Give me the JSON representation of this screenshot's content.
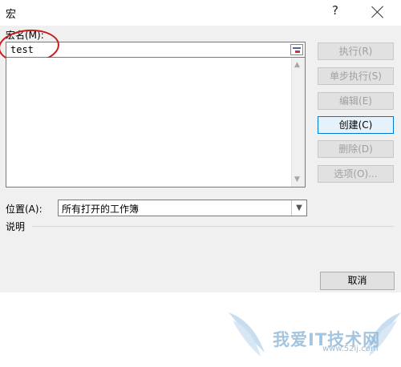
{
  "window": {
    "title": "宏",
    "help": "?"
  },
  "macro_name": {
    "label": "宏名(M):",
    "value": "test"
  },
  "buttons": {
    "run": "执行(R)",
    "step_into": "单步执行(S)",
    "edit": "编辑(E)",
    "create": "创建(C)",
    "delete": "删除(D)",
    "options": "选项(O)...",
    "cancel": "取消"
  },
  "position": {
    "label": "位置(A):",
    "value": "所有打开的工作簿"
  },
  "description": {
    "label": "说明"
  },
  "watermark": {
    "text": "我爱IT技术网",
    "url": "www.52ij.com"
  }
}
